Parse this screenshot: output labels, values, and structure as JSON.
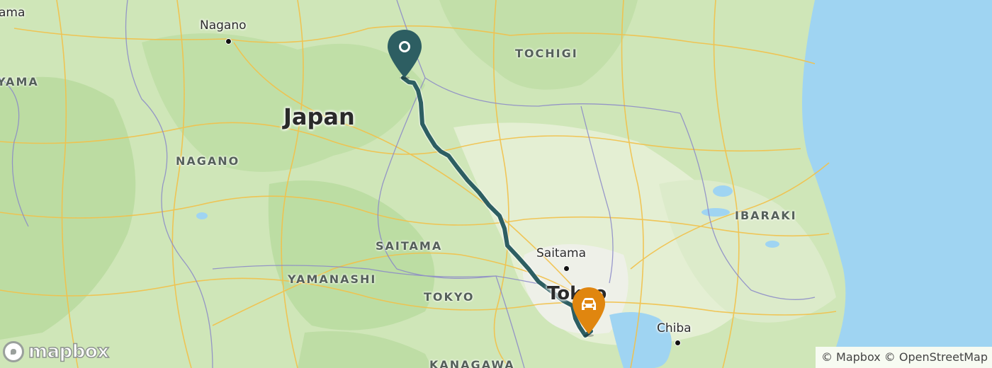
{
  "map": {
    "country_label": "Japan",
    "cities": [
      {
        "name": "Nagano",
        "id": "nagano"
      },
      {
        "name": "Saitama",
        "id": "saitama"
      },
      {
        "name": "Tokyo",
        "id": "tokyo"
      },
      {
        "name": "Chiba",
        "id": "chiba"
      }
    ],
    "prefectures": [
      {
        "name": "TOCHIGI"
      },
      {
        "name": "NAGANO"
      },
      {
        "name": "SAITAMA"
      },
      {
        "name": "YAMANASHI"
      },
      {
        "name": "TOKYO"
      },
      {
        "name": "IBARAKI"
      },
      {
        "name": "KANAGAWA"
      },
      {
        "name": "YAMA"
      }
    ],
    "partial_city": "ama",
    "route_color": "#2d5e62",
    "origin_marker": {
      "icon": "location-pin-icon",
      "color": "#2d5e62"
    },
    "destination_marker": {
      "icon": "car-icon",
      "color": "#e0860f"
    },
    "water_color": "#9fd4f2",
    "land_color": "#cfe6b8"
  },
  "branding": {
    "logo_text": "mapbox",
    "attribution": "© Mapbox © OpenStreetMap"
  }
}
